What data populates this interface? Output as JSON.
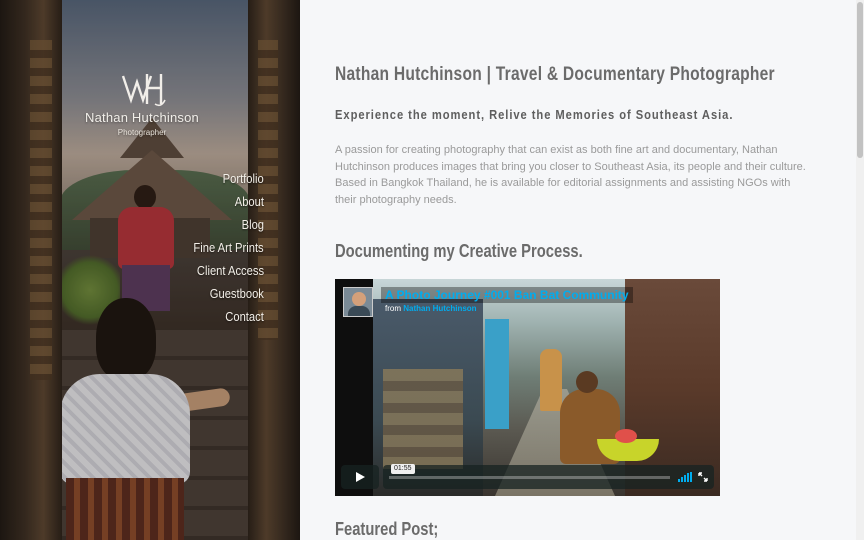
{
  "site": {
    "logo_name": "Nathan Hutchinson",
    "logo_sub": "Photographer"
  },
  "nav": {
    "items": [
      {
        "label": "Portfolio"
      },
      {
        "label": "About"
      },
      {
        "label": "Blog"
      },
      {
        "label": "Fine Art Prints"
      },
      {
        "label": "Client Access"
      },
      {
        "label": "Guestbook"
      },
      {
        "label": "Contact"
      }
    ]
  },
  "main": {
    "title": "Nathan Hutchinson | Travel & Documentary Photographer",
    "tagline": "Experience the moment, Relive the Memories of Southeast Asia.",
    "intro": "A passion for creating photography that can exist as both fine art and documentary, Nathan Hutchinson produces images that bring you closer to Southeast Asia, its people and their culture. Based in Bangkok Thailand, he is available for editorial assignments and assisting NGOs with their photography needs.",
    "section_title": "Documenting my Creative Process.",
    "featured_title": "Featured Post;"
  },
  "video": {
    "title": "A Photo Journey #001 Ban Bat Community",
    "from_prefix": "from",
    "from_author": "Nathan Hutchinson",
    "time": "01:55"
  },
  "colors": {
    "accent": "#00adef",
    "heading": "#6b6b6b",
    "body_text": "#9a9a9a",
    "background": "#f6f7f9"
  },
  "icons": {
    "play": "play-icon",
    "volume": "volume-icon",
    "fullscreen": "fullscreen-icon"
  }
}
